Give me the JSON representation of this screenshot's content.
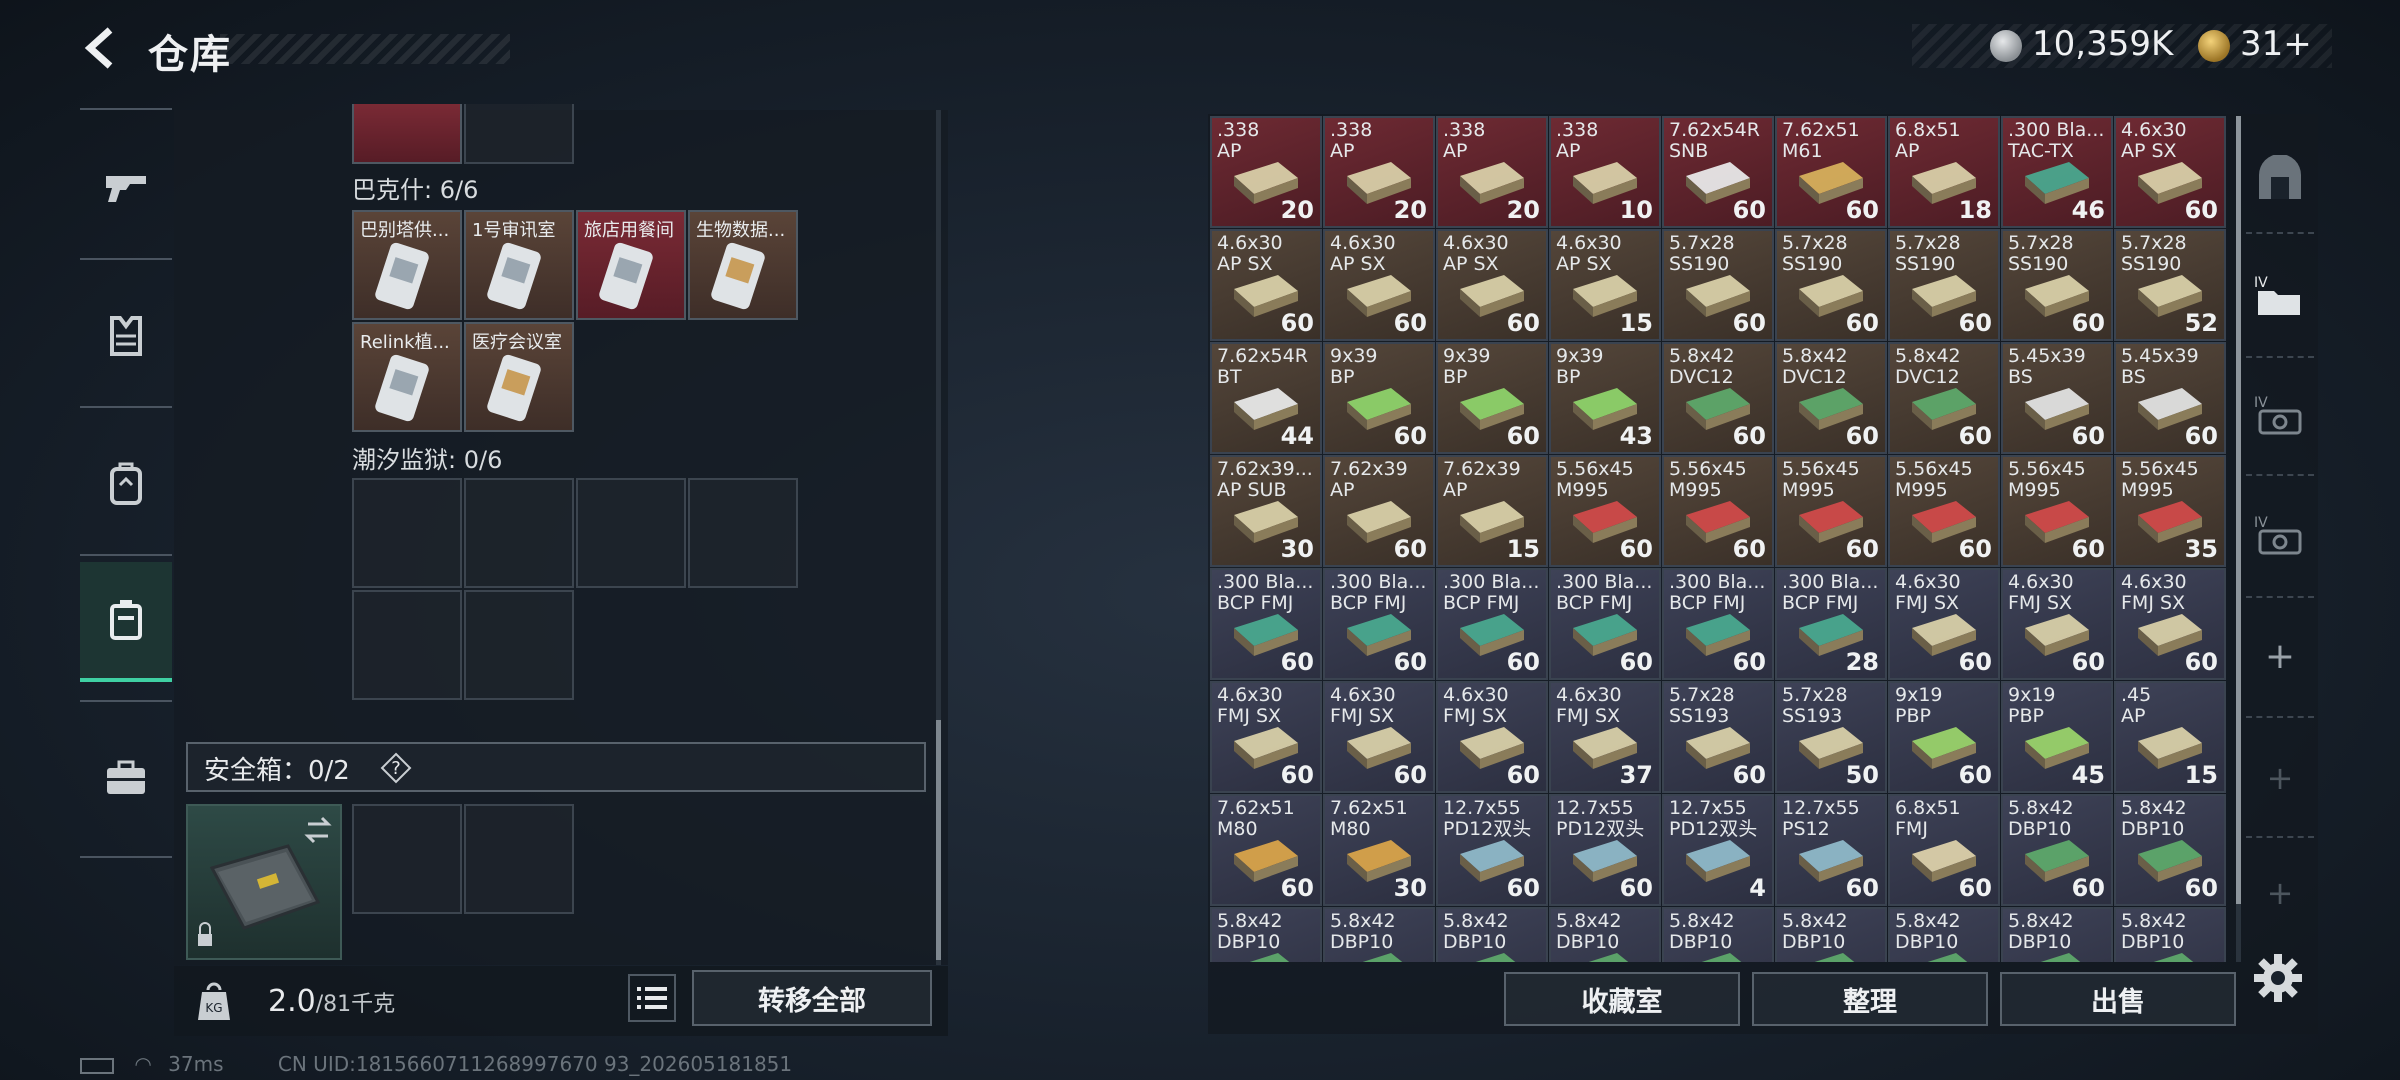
{
  "header": {
    "title": "仓库",
    "money": "10,359K",
    "tokens": "31+"
  },
  "sidebar": {
    "items": [
      "weapon",
      "armor",
      "backpack",
      "container",
      "briefcase"
    ]
  },
  "storage": {
    "section_bakesh": "巴克什: 6/6",
    "cards": [
      {
        "label": "巴别塔供..."
      },
      {
        "label": "1号审讯室"
      },
      {
        "label": "旅店用餐间"
      },
      {
        "label": "生物数据..."
      },
      {
        "label": "Relink植..."
      },
      {
        "label": "医疗会议室"
      }
    ],
    "section_tide": "潮汐监狱: 0/6",
    "safe_label": "安全箱：0/2",
    "safe_help": "?"
  },
  "footer": {
    "weight": "2.0",
    "weight_unit": "/81千克",
    "transfer_all": "转移全部"
  },
  "status": {
    "ping": "37ms",
    "uid": "CN UID:1815660711268997670 93_202605181851"
  },
  "ammo": [
    {
      "name": ".338\nAP",
      "qty": "20",
      "c": "r"
    },
    {
      "name": ".338\nAP",
      "qty": "20",
      "c": "r"
    },
    {
      "name": ".338\nAP",
      "qty": "20",
      "c": "r"
    },
    {
      "name": ".338\nAP",
      "qty": "10",
      "c": "r"
    },
    {
      "name": "7.62x54R\nSNB",
      "qty": "60",
      "c": "r"
    },
    {
      "name": "7.62x51\nM61",
      "qty": "60",
      "c": "r"
    },
    {
      "name": "6.8x51\nAP",
      "qty": "18",
      "c": "r"
    },
    {
      "name": ".300 Bla...\nTAC-TX",
      "qty": "46",
      "c": "r"
    },
    {
      "name": "4.6x30\nAP SX",
      "qty": "60",
      "c": "r"
    },
    {
      "name": "4.6x30\nAP SX",
      "qty": "60",
      "c": "b"
    },
    {
      "name": "4.6x30\nAP SX",
      "qty": "60",
      "c": "b"
    },
    {
      "name": "4.6x30\nAP SX",
      "qty": "60",
      "c": "b"
    },
    {
      "name": "4.6x30\nAP SX",
      "qty": "15",
      "c": "b"
    },
    {
      "name": "5.7x28\nSS190",
      "qty": "60",
      "c": "b"
    },
    {
      "name": "5.7x28\nSS190",
      "qty": "60",
      "c": "b"
    },
    {
      "name": "5.7x28\nSS190",
      "qty": "60",
      "c": "b"
    },
    {
      "name": "5.7x28\nSS190",
      "qty": "60",
      "c": "b"
    },
    {
      "name": "5.7x28\nSS190",
      "qty": "52",
      "c": "b"
    },
    {
      "name": "7.62x54R\nBT",
      "qty": "44",
      "c": "b"
    },
    {
      "name": "9x39\nBP",
      "qty": "60",
      "c": "b"
    },
    {
      "name": "9x39\nBP",
      "qty": "60",
      "c": "b"
    },
    {
      "name": "9x39\nBP",
      "qty": "43",
      "c": "b"
    },
    {
      "name": "5.8x42\nDVC12",
      "qty": "60",
      "c": "b"
    },
    {
      "name": "5.8x42\nDVC12",
      "qty": "60",
      "c": "b"
    },
    {
      "name": "5.8x42\nDVC12",
      "qty": "60",
      "c": "b"
    },
    {
      "name": "5.45x39\nBS",
      "qty": "60",
      "c": "b"
    },
    {
      "name": "5.45x39\nBS",
      "qty": "60",
      "c": "b"
    },
    {
      "name": "7.62x39...\nAP SUB",
      "qty": "30",
      "c": "b"
    },
    {
      "name": "7.62x39\nAP",
      "qty": "60",
      "c": "b"
    },
    {
      "name": "7.62x39\nAP",
      "qty": "15",
      "c": "b"
    },
    {
      "name": "5.56x45\nM995",
      "qty": "60",
      "c": "b"
    },
    {
      "name": "5.56x45\nM995",
      "qty": "60",
      "c": "b"
    },
    {
      "name": "5.56x45\nM995",
      "qty": "60",
      "c": "b"
    },
    {
      "name": "5.56x45\nM995",
      "qty": "60",
      "c": "b"
    },
    {
      "name": "5.56x45\nM995",
      "qty": "60",
      "c": "b"
    },
    {
      "name": "5.56x45\nM995",
      "qty": "35",
      "c": "b"
    },
    {
      "name": ".300 Bla...\nBCP FMJ",
      "qty": "60",
      "c": "p"
    },
    {
      "name": ".300 Bla...\nBCP FMJ",
      "qty": "60",
      "c": "p"
    },
    {
      "name": ".300 Bla...\nBCP FMJ",
      "qty": "60",
      "c": "p"
    },
    {
      "name": ".300 Bla...\nBCP FMJ",
      "qty": "60",
      "c": "p"
    },
    {
      "name": ".300 Bla...\nBCP FMJ",
      "qty": "60",
      "c": "p"
    },
    {
      "name": ".300 Bla...\nBCP FMJ",
      "qty": "28",
      "c": "p"
    },
    {
      "name": "4.6x30\nFMJ SX",
      "qty": "60",
      "c": "p"
    },
    {
      "name": "4.6x30\nFMJ SX",
      "qty": "60",
      "c": "p"
    },
    {
      "name": "4.6x30\nFMJ SX",
      "qty": "60",
      "c": "p"
    },
    {
      "name": "4.6x30\nFMJ SX",
      "qty": "60",
      "c": "p"
    },
    {
      "name": "4.6x30\nFMJ SX",
      "qty": "60",
      "c": "p"
    },
    {
      "name": "4.6x30\nFMJ SX",
      "qty": "60",
      "c": "p"
    },
    {
      "name": "4.6x30\nFMJ SX",
      "qty": "37",
      "c": "p"
    },
    {
      "name": "5.7x28\nSS193",
      "qty": "60",
      "c": "p"
    },
    {
      "name": "5.7x28\nSS193",
      "qty": "50",
      "c": "p"
    },
    {
      "name": "9x19\nPBP",
      "qty": "60",
      "c": "p"
    },
    {
      "name": "9x19\nPBP",
      "qty": "45",
      "c": "p"
    },
    {
      "name": ".45\nAP",
      "qty": "15",
      "c": "p"
    },
    {
      "name": "7.62x51\nM80",
      "qty": "60",
      "c": "p"
    },
    {
      "name": "7.62x51\nM80",
      "qty": "30",
      "c": "p"
    },
    {
      "name": "12.7x55\nPD12双头",
      "qty": "60",
      "c": "p"
    },
    {
      "name": "12.7x55\nPD12双头",
      "qty": "60",
      "c": "p"
    },
    {
      "name": "12.7x55\nPD12双头",
      "qty": "4",
      "c": "p"
    },
    {
      "name": "12.7x55\nPS12",
      "qty": "60",
      "c": "p"
    },
    {
      "name": "6.8x51\nFMJ",
      "qty": "60",
      "c": "p"
    },
    {
      "name": "5.8x42\nDBP10",
      "qty": "60",
      "c": "p"
    },
    {
      "name": "5.8x42\nDBP10",
      "qty": "60",
      "c": "p"
    },
    {
      "name": "5.8x42\nDBP10",
      "qty": "",
      "c": "p"
    },
    {
      "name": "5.8x42\nDBP10",
      "qty": "",
      "c": "p"
    },
    {
      "name": "5.8x42\nDBP10",
      "qty": "",
      "c": "p"
    },
    {
      "name": "5.8x42\nDBP10",
      "qty": "",
      "c": "p"
    },
    {
      "name": "5.8x42\nDBP10",
      "qty": "",
      "c": "p"
    },
    {
      "name": "5.8x42\nDBP10",
      "qty": "",
      "c": "p"
    },
    {
      "name": "5.8x42\nDBP10",
      "qty": "",
      "c": "p"
    },
    {
      "name": "5.8x42\nDBP10",
      "qty": "",
      "c": "p"
    },
    {
      "name": "5.8x42\nDBP10",
      "qty": "",
      "c": "p"
    }
  ],
  "actions": {
    "collection": "收藏室",
    "organize": "整理",
    "sell": "出售"
  },
  "rail": {
    "plus": "+"
  },
  "colors": {
    "accent": "#3fd0a3",
    "red_slot": "#6e2a33",
    "brown_slot": "#54463a",
    "purple_slot": "#3e4257"
  }
}
